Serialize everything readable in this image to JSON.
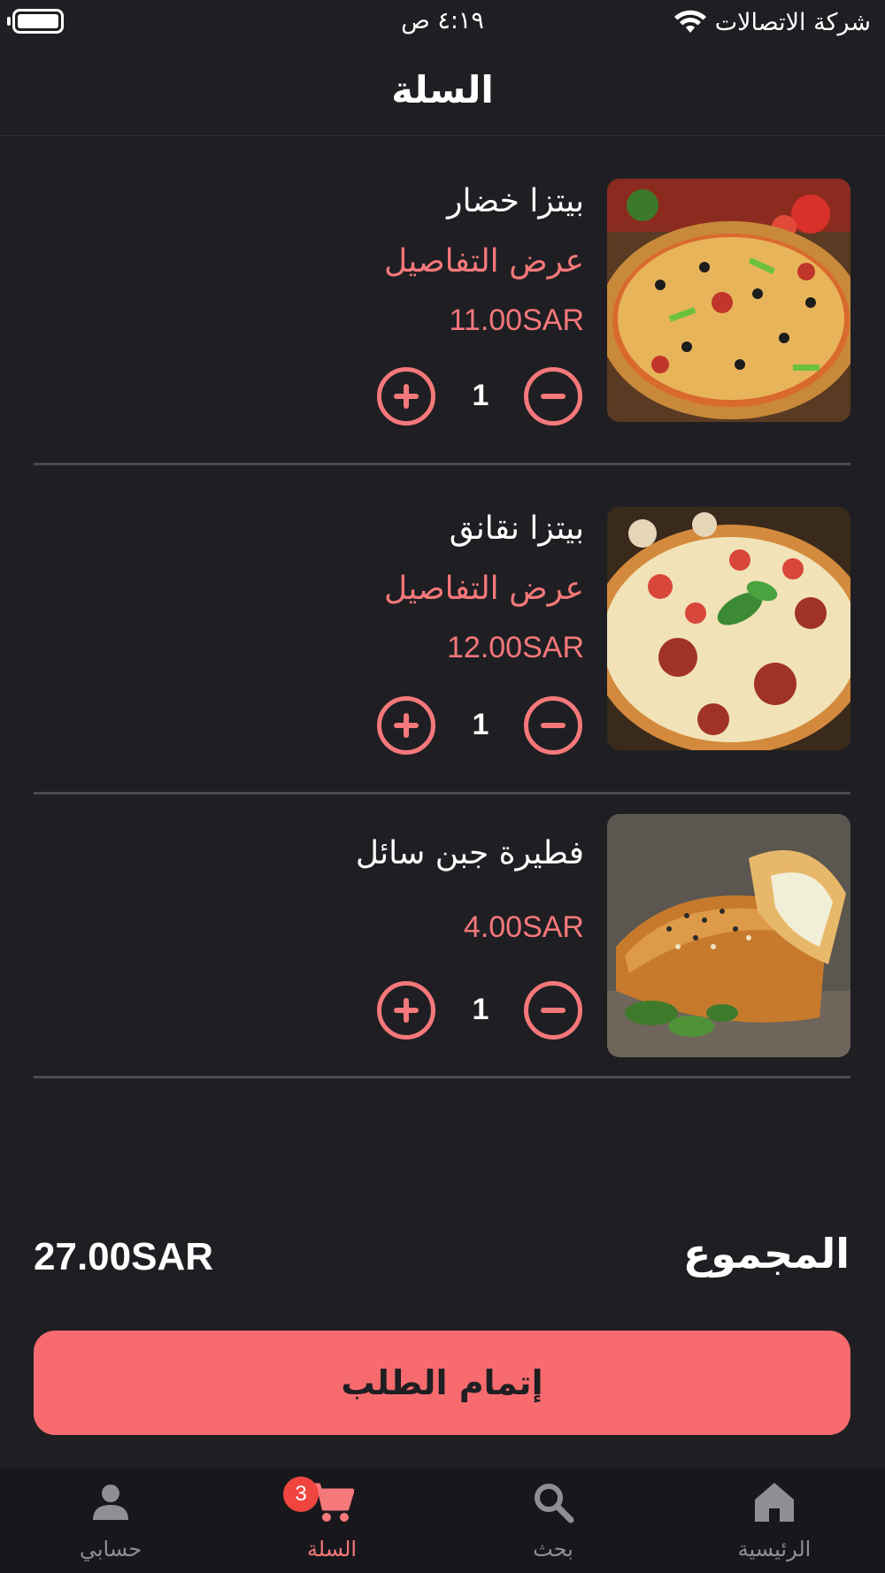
{
  "status_bar": {
    "time": "٤:١٩ ص",
    "carrier": "شركة الاتصالات"
  },
  "header": {
    "title": "السلة"
  },
  "cart": {
    "items": [
      {
        "name": "بيتزا خضار",
        "details_link": "عرض التفاصيل",
        "price": "11.00SAR",
        "quantity": "1",
        "image_icon": "veggie-pizza-photo"
      },
      {
        "name": "بيتزا نقانق",
        "details_link": "عرض التفاصيل",
        "price": "12.00SAR",
        "quantity": "1",
        "image_icon": "sausage-pizza-photo"
      },
      {
        "name": "فطيرة جبن سائل",
        "price": "4.00SAR",
        "quantity": "1",
        "image_icon": "cheese-pastry-photo"
      }
    ]
  },
  "summary": {
    "total_label": "المجموع",
    "total_value": "27.00SAR"
  },
  "checkout": {
    "label": "إتمام الطلب"
  },
  "tab_bar": {
    "tabs": [
      {
        "label": "حسابي",
        "icon": "person-icon"
      },
      {
        "label": "السلة",
        "icon": "cart-icon",
        "active": true
      },
      {
        "label": "بحث",
        "icon": "search-icon"
      },
      {
        "label": "الرئيسية",
        "icon": "home-icon"
      }
    ],
    "cart_badge": "3"
  },
  "colors": {
    "background": "#1f1f23",
    "accent": "#f5787a",
    "button": "#f76b6e",
    "badge": "#f0453f",
    "tab_inactive": "#8e8e93"
  }
}
